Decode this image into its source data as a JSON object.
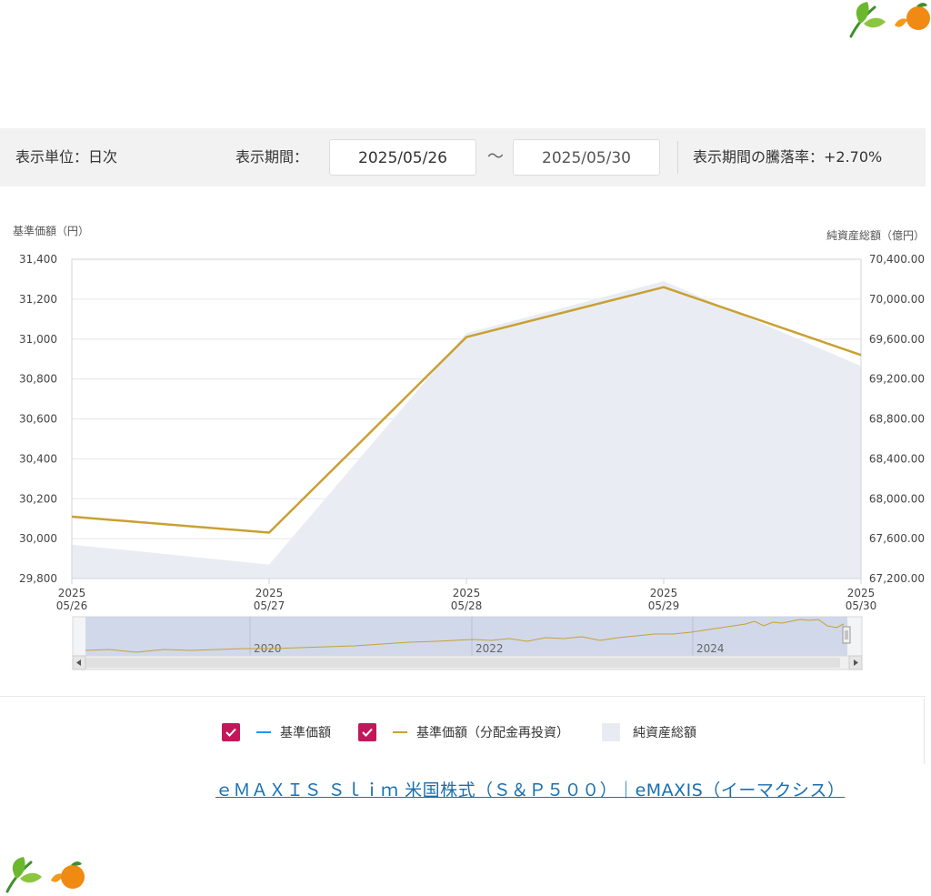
{
  "header": {
    "unit_label": "表示単位：日次",
    "period_label": "表示期間：",
    "start_date": "2025/05/26",
    "tilde": "～",
    "end_date": "2025/05/30",
    "change_label": "表示期間の騰落率：+2.70%"
  },
  "chart_data": {
    "type": "line",
    "left_axis_title": "基準価額（円）",
    "right_axis_title": "純資産総額（億円）",
    "x": [
      "2025-05-26",
      "2025-05-27",
      "2025-05-28",
      "2025-05-29",
      "2025-05-30"
    ],
    "x_tick_years": [
      "2025",
      "2025",
      "2025",
      "2025",
      "2025"
    ],
    "x_tick_days": [
      "05/26",
      "05/27",
      "05/28",
      "05/29",
      "05/30"
    ],
    "y_left_ticks": [
      "31,400",
      "31,200",
      "31,000",
      "30,800",
      "30,600",
      "30,400",
      "30,200",
      "30,000",
      "29,800"
    ],
    "y_right_ticks": [
      "70,400.00",
      "70,000.00",
      "69,600.00",
      "69,200.00",
      "68,800.00",
      "68,400.00",
      "68,000.00",
      "67,600.00",
      "67,200.00"
    ],
    "ylim_left": [
      29800,
      31400
    ],
    "ylim_right": [
      67200,
      70400
    ],
    "series": [
      {
        "name": "基準価額（分配金再投資）",
        "axis": "left",
        "color": "#c9a033",
        "values": [
          30110,
          30030,
          31010,
          31260,
          30920
        ]
      },
      {
        "name": "純資産総額",
        "axis": "right",
        "color": "#e9edf3",
        "values": [
          67540,
          67340,
          69660,
          70180,
          69330
        ]
      }
    ],
    "navigator_year_labels": [
      "2020",
      "2022",
      "2024"
    ],
    "grid": true
  },
  "legend": {
    "item1": "基準価額",
    "item1_color": "#2196f3",
    "item2": "基準価額（分配金再投資）",
    "item2_color": "#c9a033",
    "item3": "純資産総額"
  },
  "source": {
    "link_text": "ｅＭＡＸＩＳ Ｓｌｉｍ 米国株式（Ｓ＆Ｐ５００）｜eMAXIS（イーマクシス）"
  },
  "icons": {
    "decoration": "tea-leaf-mandarin-icon",
    "checkbox": "checkmark-icon",
    "scroll_left": "arrow-left-icon",
    "scroll_right": "arrow-right-icon"
  }
}
